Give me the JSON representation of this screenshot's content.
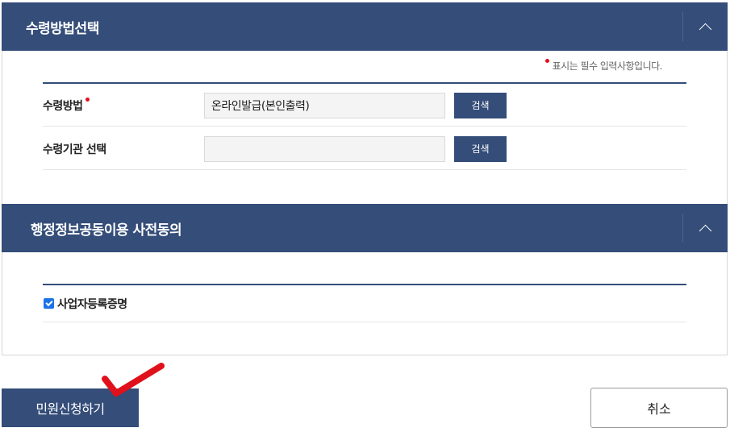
{
  "section1": {
    "title": "수령방법선택",
    "required_note": "표시는 필수 입력사항입니다.",
    "rows": [
      {
        "label": "수령방법",
        "value": "온라인발급(본인출력)",
        "button": "검색"
      },
      {
        "label": "수령기관 선택",
        "value": "",
        "button": "검색"
      }
    ]
  },
  "section2": {
    "title": "행정정보공동이용 사전동의",
    "checkbox_label": "사업자등록증명",
    "checked": true
  },
  "actions": {
    "submit_label": "민원신청하기",
    "cancel_label": "취소"
  },
  "colors": {
    "header_bg": "#344d79",
    "required_dot": "#e0111a",
    "annotation_check": "#e0111a"
  }
}
